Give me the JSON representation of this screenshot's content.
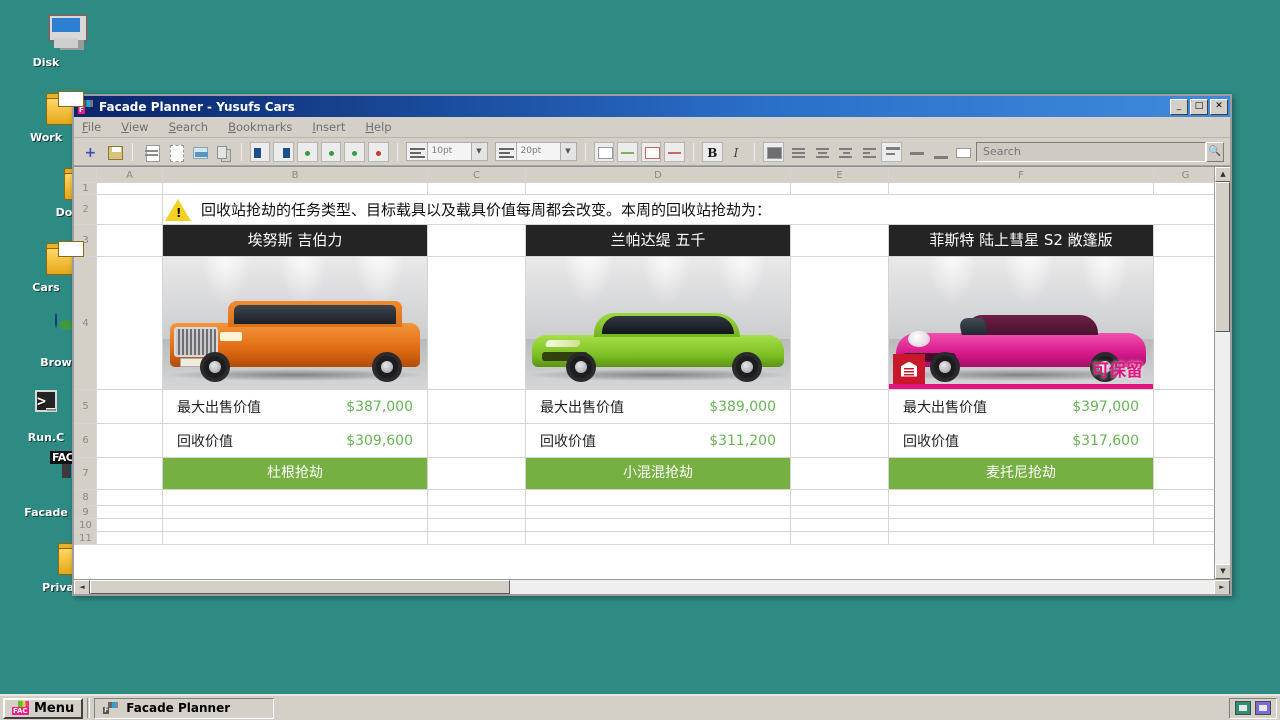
{
  "desktop": {
    "icons": [
      {
        "label": "Disk",
        "icon": "computer-icon"
      },
      {
        "label": "Work",
        "icon": "folder-icon"
      },
      {
        "label": "Do",
        "icon": "folder-icon"
      },
      {
        "label": "Cars",
        "icon": "folder-icon"
      },
      {
        "label": "Brow",
        "icon": "globe-icon"
      },
      {
        "label": "Run.C",
        "icon": "terminal-icon"
      },
      {
        "label": "Facade",
        "icon": "facade-app-icon"
      },
      {
        "label": "Priva",
        "icon": "folder-icon"
      }
    ]
  },
  "window": {
    "title": "Facade Planner - Yusufs Cars",
    "controls": {
      "minimize": "_",
      "maximize": "□",
      "close": "✕"
    },
    "menu": [
      {
        "label": "File",
        "accel": "F"
      },
      {
        "label": "View",
        "accel": "V"
      },
      {
        "label": "Search",
        "accel": "S"
      },
      {
        "label": "Bookmarks",
        "accel": "B"
      },
      {
        "label": "Insert",
        "accel": "I"
      },
      {
        "label": "Help",
        "accel": "H"
      }
    ]
  },
  "toolbar": {
    "font_size_small": "10pt",
    "font_size_large": "20pt",
    "bold_label": "B",
    "italic_label": "I",
    "dropdown_arrow": "▼",
    "icons": [
      "new-document-icon",
      "save-icon",
      "page-icon",
      "select-area-icon",
      "insert-image-icon",
      "copy-icon",
      "split-left-icon",
      "split-right-icon",
      "insert-row-above-icon",
      "insert-row-below-icon",
      "insert-column-icon",
      "delete-row-icon",
      "merge-cells-icon",
      "unmerge-cells-icon",
      "cell-color-icon",
      "clear-format-icon",
      "border-icon",
      "align-left-icon",
      "align-center-icon",
      "indent-decrease-icon",
      "indent-increase-icon",
      "align-top-icon",
      "align-middle-icon",
      "align-bottom-icon",
      "wrap-text-icon"
    ]
  },
  "search": {
    "placeholder": "Search",
    "value": "",
    "button_icon": "search-icon"
  },
  "sheet": {
    "columns": [
      "A",
      "B",
      "C",
      "D",
      "E",
      "F",
      "G"
    ],
    "rows": [
      "1",
      "2",
      "3",
      "4",
      "5",
      "6",
      "7",
      "8",
      "9",
      "10",
      "11"
    ],
    "banner": {
      "icon": "warning-icon",
      "text": "回收站抢劫的任务类型、目标载具以及载具价值每周都会改变。本周的回收站抢劫为："
    },
    "cars": [
      {
        "title": "埃努斯 吉伯力",
        "photo": "orange-suv-photo",
        "keepable": false,
        "keepable_label": "",
        "sale_label": "最大出售价值",
        "sale_value": "$387,000",
        "recycle_label": "回收价值",
        "recycle_value": "$309,600",
        "heist": "杜根抢劫"
      },
      {
        "title": "兰帕达缇 五千",
        "photo": "green-coupe-photo",
        "keepable": false,
        "keepable_label": "",
        "sale_label": "最大出售价值",
        "sale_value": "$389,000",
        "recycle_label": "回收价值",
        "recycle_value": "$311,200",
        "heist": "小混混抢劫"
      },
      {
        "title": "菲斯特 陆上彗星 S2 敞篷版",
        "photo": "pink-convertible-photo",
        "keepable": true,
        "keepable_label": "可保留",
        "sale_label": "最大出售价值",
        "sale_value": "$397,000",
        "recycle_label": "回收价值",
        "recycle_value": "$317,600",
        "heist": "麦托尼抢劫"
      }
    ]
  },
  "scrollbars": {
    "up": "▲",
    "down": "▼",
    "left": "◄",
    "right": "►"
  },
  "taskbar": {
    "menu_label": "Menu",
    "task_label": "Facade Planner",
    "tray": [
      "network-icon",
      "volume-icon"
    ]
  },
  "colors": {
    "desktop": "#2e8b84",
    "title_bar": "#0a246a",
    "heist_green": "#76b043",
    "value_green": "#69b356",
    "keep_pink": "#e0157f",
    "car_header": "#242424"
  }
}
